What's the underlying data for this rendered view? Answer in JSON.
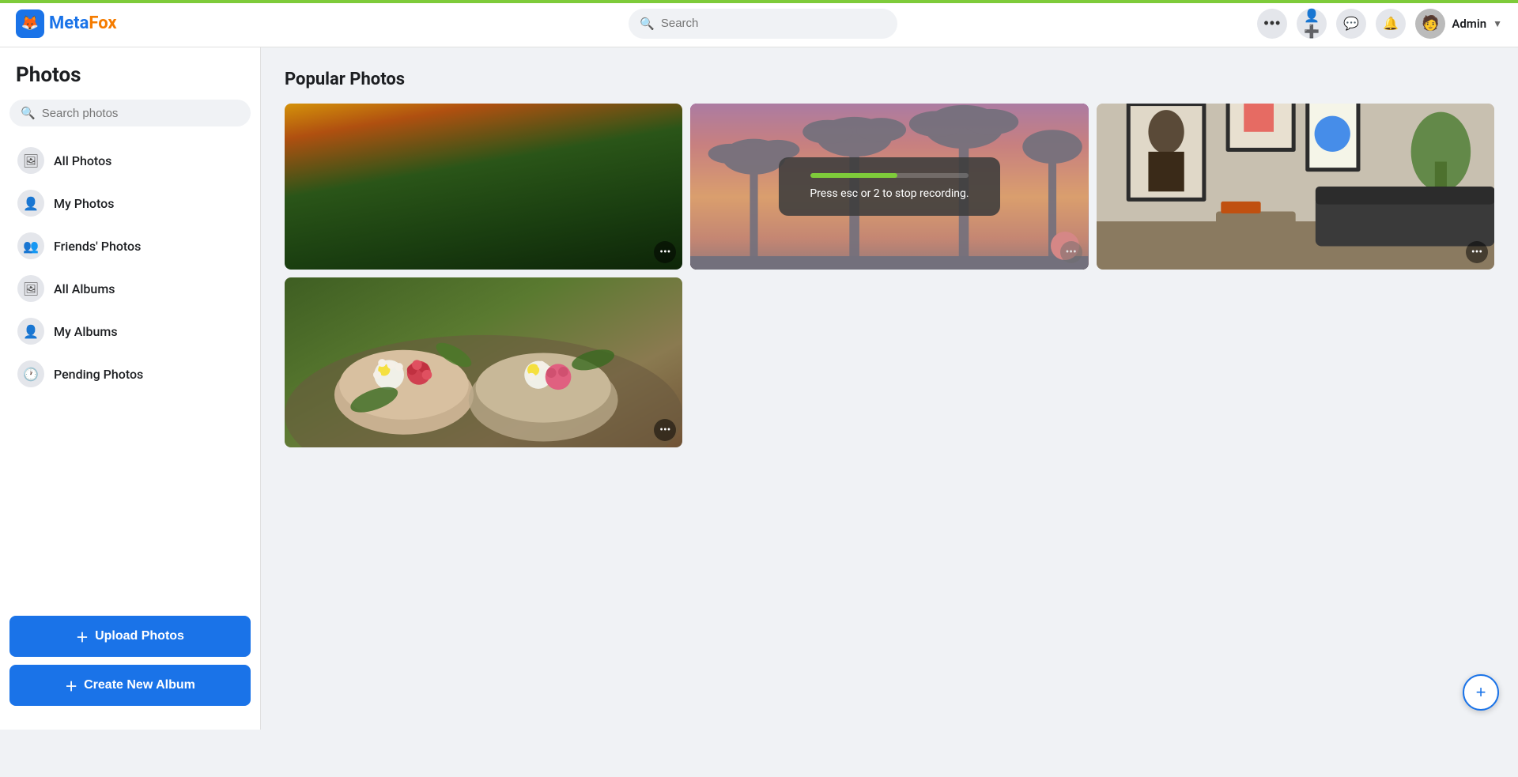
{
  "topnav": {
    "logo_meta": "Meta",
    "logo_fox": "Fox",
    "search_placeholder": "Search",
    "user_name": "Admin",
    "dots_label": "•••",
    "add_friend_title": "Add friend",
    "message_title": "Messages",
    "notification_title": "Notifications"
  },
  "sidebar": {
    "title": "Photos",
    "search_placeholder": "Search photos",
    "nav_items": [
      {
        "id": "all-photos",
        "label": "All Photos",
        "icon": "🖼"
      },
      {
        "id": "my-photos",
        "label": "My Photos",
        "icon": "👤"
      },
      {
        "id": "friends-photos",
        "label": "Friends' Photos",
        "icon": "👥"
      },
      {
        "id": "all-albums",
        "label": "All Albums",
        "icon": "🖼"
      },
      {
        "id": "my-albums",
        "label": "My Albums",
        "icon": "👤"
      },
      {
        "id": "pending-photos",
        "label": "Pending Photos",
        "icon": "🕐"
      }
    ],
    "upload_btn": "Upload Photos",
    "create_album_btn": "Create New Album"
  },
  "main": {
    "section_title": "Popular Photos",
    "recording_text": "Press esc or 2 to stop recording."
  },
  "fab": {
    "label": "+"
  }
}
